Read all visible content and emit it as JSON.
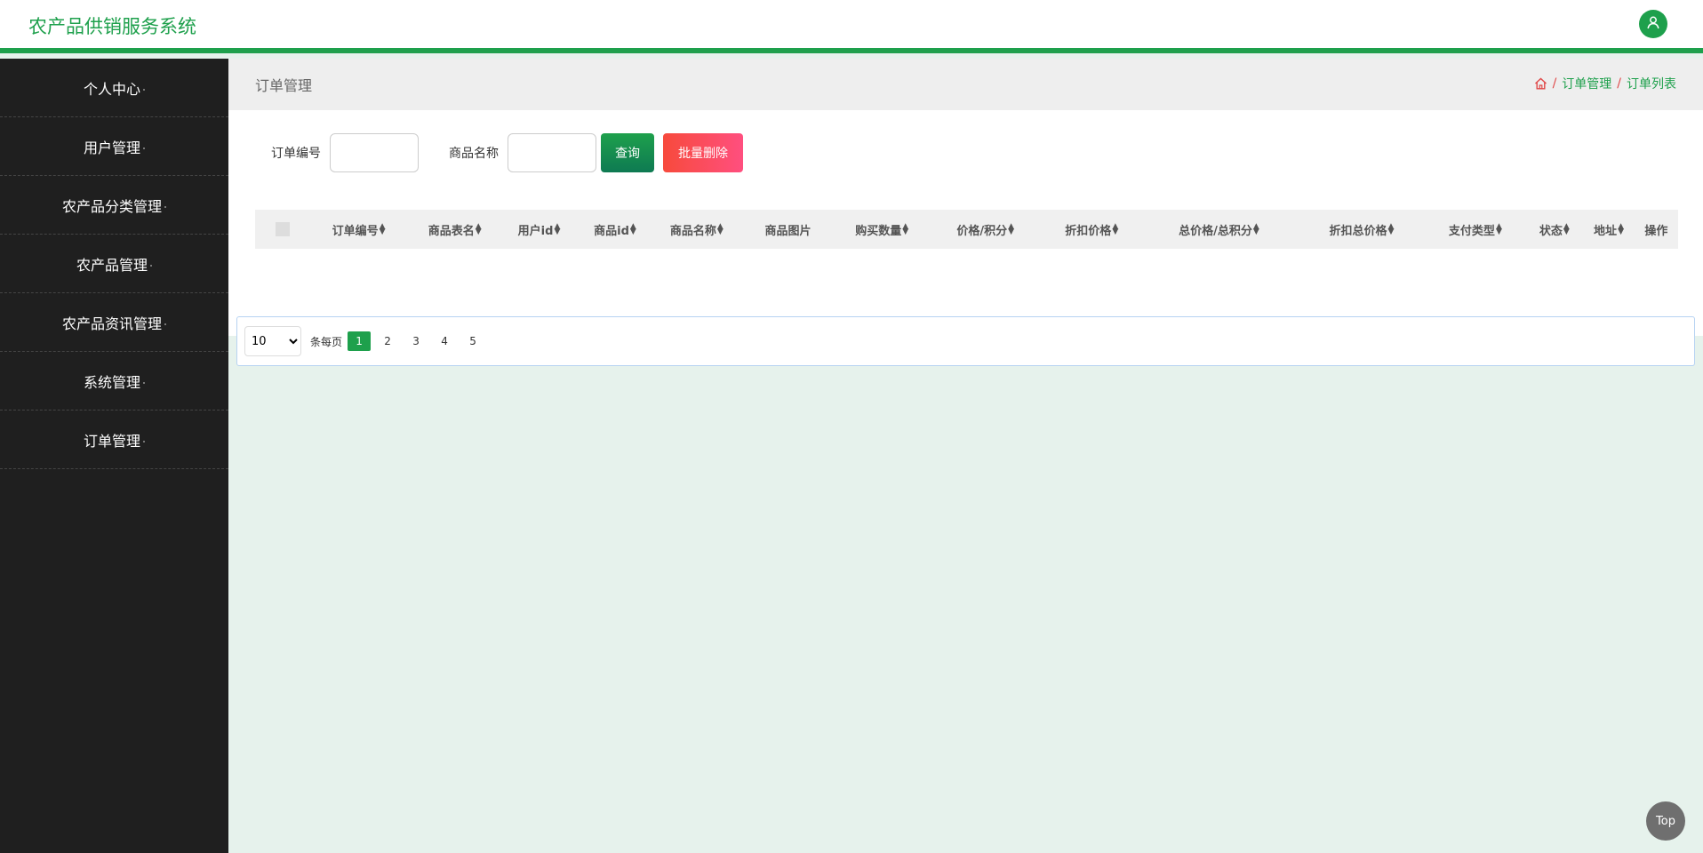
{
  "header": {
    "title": "农产品供销服务系统",
    "avatar_icon": "user-icon"
  },
  "sidebar": {
    "items": [
      {
        "label": "个人中心"
      },
      {
        "label": "用户管理"
      },
      {
        "label": "农产品分类管理"
      },
      {
        "label": "农产品管理"
      },
      {
        "label": "农产品资讯管理"
      },
      {
        "label": "系统管理"
      },
      {
        "label": "订单管理"
      }
    ]
  },
  "page": {
    "title": "订单管理",
    "breadcrumb": {
      "home_icon": "home-icon",
      "sep": "/",
      "level1": "订单管理",
      "level2": "订单列表"
    }
  },
  "search": {
    "order_label": "订单编号",
    "order_value": "",
    "product_label": "商品名称",
    "product_value": "",
    "query_label": "查询",
    "batch_delete_label": "批量删除"
  },
  "table": {
    "columns": [
      {
        "label": "订单编号",
        "sortable": true
      },
      {
        "label": "商品表名",
        "sortable": true
      },
      {
        "label": "用户id",
        "sortable": true
      },
      {
        "label": "商品id",
        "sortable": true
      },
      {
        "label": "商品名称",
        "sortable": true
      },
      {
        "label": "商品图片",
        "sortable": false
      },
      {
        "label": "购买数量",
        "sortable": true
      },
      {
        "label": "价格/积分",
        "sortable": true
      },
      {
        "label": "折扣价格",
        "sortable": true
      },
      {
        "label": "总价格/总积分",
        "sortable": true
      },
      {
        "label": "折扣总价格",
        "sortable": true
      },
      {
        "label": "支付类型",
        "sortable": true
      },
      {
        "label": "状态",
        "sortable": true
      },
      {
        "label": "地址",
        "sortable": true
      },
      {
        "label": "操作",
        "sortable": false
      }
    ],
    "rows": []
  },
  "pagination": {
    "page_size": "10",
    "per_page_text": "条每页",
    "pages": [
      "1",
      "2",
      "3",
      "4",
      "5"
    ],
    "current": "1"
  },
  "back_to_top": "Top",
  "colors": {
    "accent": "#1ea04c",
    "danger": "#f74a3c",
    "sidebar_bg": "#1f1f1f"
  }
}
